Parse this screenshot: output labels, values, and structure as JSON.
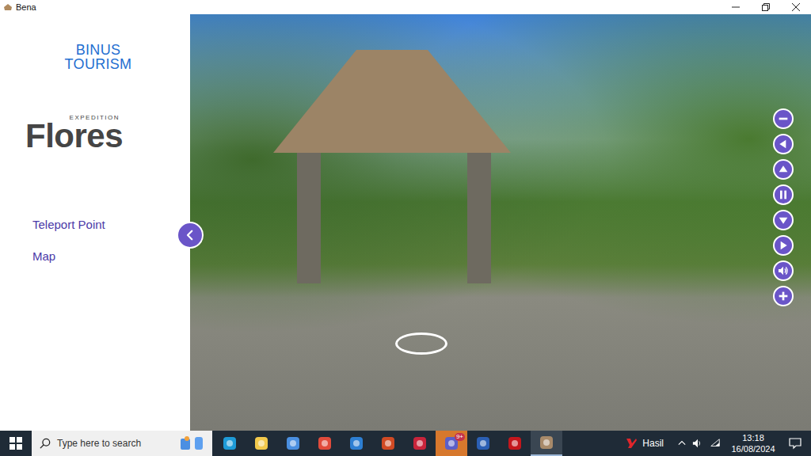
{
  "window": {
    "title": "Bena"
  },
  "sidebar": {
    "brand": [
      "BINUS",
      "TOURISM"
    ],
    "expedition": {
      "tag": "EXPEDITION",
      "name": "Flores"
    },
    "items": [
      {
        "label": "Teleport Point"
      },
      {
        "label": "Map"
      }
    ]
  },
  "viewer": {
    "controls": [
      {
        "kind": "zoom-out"
      },
      {
        "kind": "left"
      },
      {
        "kind": "up"
      },
      {
        "kind": "pause"
      },
      {
        "kind": "down"
      },
      {
        "kind": "right"
      },
      {
        "kind": "sound"
      },
      {
        "kind": "zoom-in"
      }
    ]
  },
  "taskbar": {
    "search": {
      "placeholder": "Type here to search"
    },
    "apps": [
      {
        "kind": "edge",
        "selected": false,
        "flashing": false
      },
      {
        "kind": "explorer",
        "selected": false,
        "flashing": false
      },
      {
        "kind": "store",
        "selected": false,
        "flashing": false
      },
      {
        "kind": "chrome",
        "selected": false,
        "flashing": false
      },
      {
        "kind": "mail",
        "selected": false,
        "flashing": false
      },
      {
        "kind": "powerpoint",
        "selected": false,
        "flashing": false
      },
      {
        "kind": "mendeley",
        "selected": false,
        "flashing": false
      },
      {
        "kind": "teams",
        "selected": false,
        "flashing": true,
        "badge": "9+"
      },
      {
        "kind": "word",
        "selected": false,
        "flashing": false
      },
      {
        "kind": "acrobat",
        "selected": false,
        "flashing": false
      },
      {
        "kind": "bena",
        "selected": true,
        "flashing": false
      }
    ],
    "weather": {
      "label": "Hasil"
    },
    "clock": {
      "time": "13:18",
      "date": "16/08/2024"
    }
  }
}
